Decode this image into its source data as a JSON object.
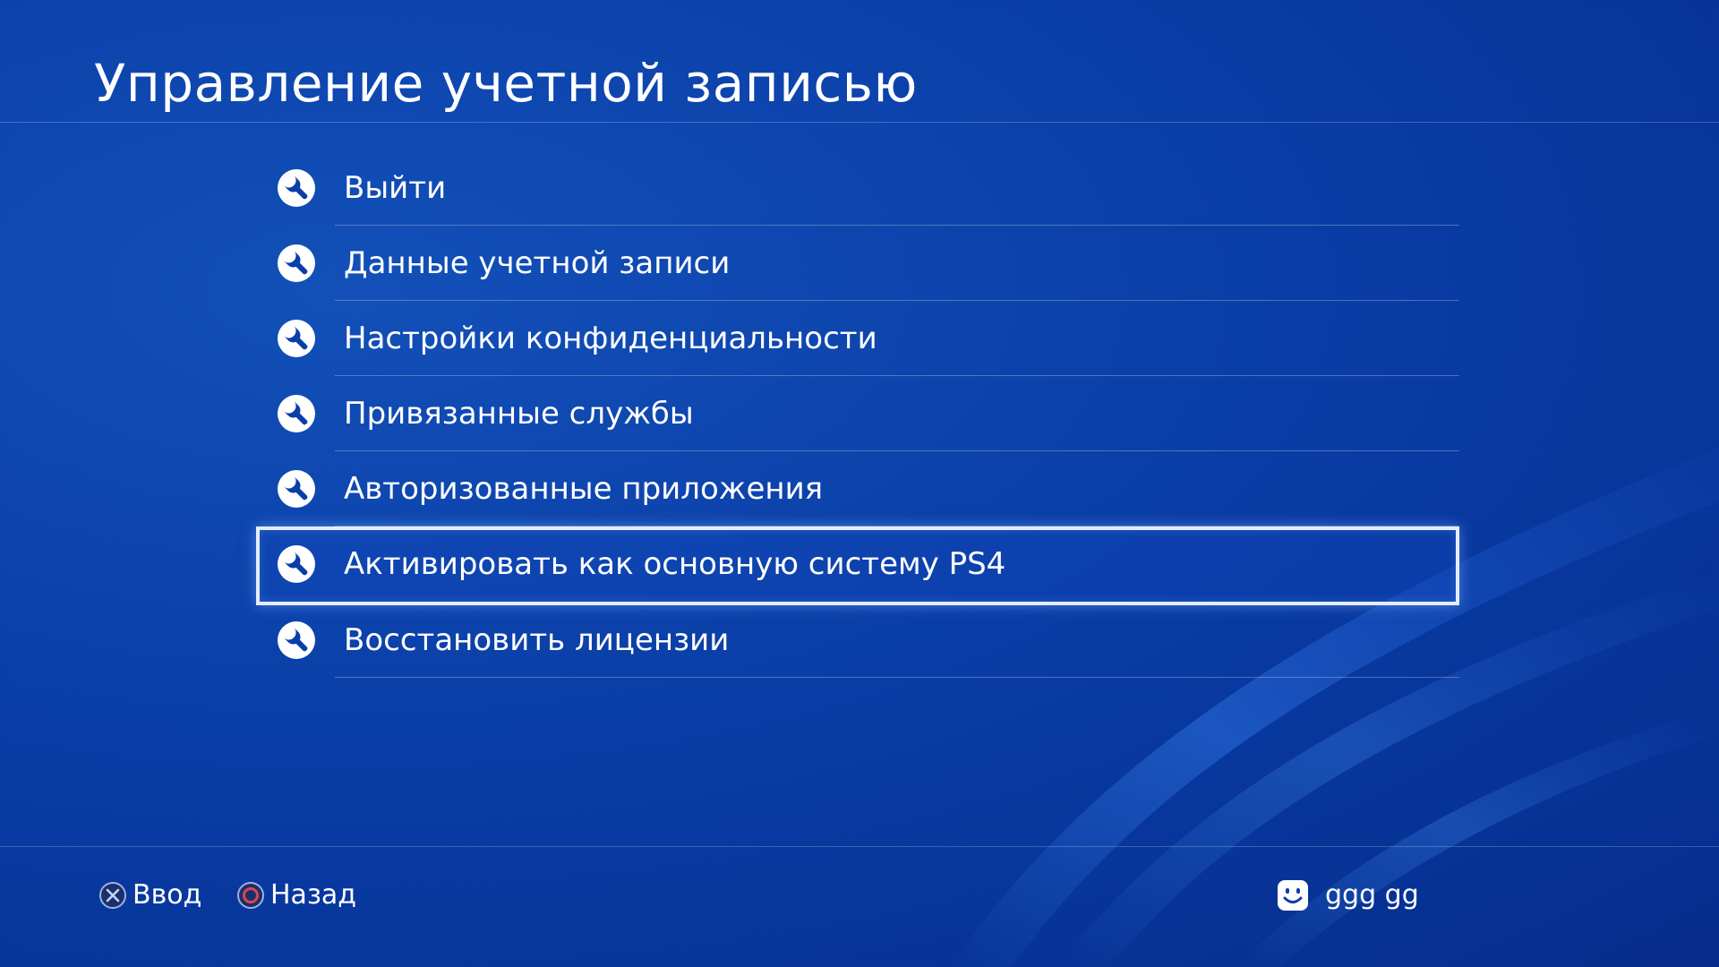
{
  "header": {
    "title": "Управление учетной записью"
  },
  "menu": {
    "selected_index": 5,
    "items": [
      {
        "label": "Выйти",
        "icon": "wrench-icon"
      },
      {
        "label": "Данные учетной записи",
        "icon": "wrench-icon"
      },
      {
        "label": "Настройки конфиденциальности",
        "icon": "wrench-icon"
      },
      {
        "label": "Привязанные службы",
        "icon": "wrench-icon"
      },
      {
        "label": "Авторизованные приложения",
        "icon": "wrench-icon"
      },
      {
        "label": "Активировать как основную систему PS4",
        "icon": "wrench-icon"
      },
      {
        "label": "Восстановить лицензии",
        "icon": "wrench-icon"
      }
    ]
  },
  "footer": {
    "enter": {
      "label": "Ввод",
      "icon": "cross-button-icon"
    },
    "back": {
      "label": "Назад",
      "icon": "circle-button-icon"
    },
    "user": {
      "name": "ggg gg",
      "icon": "avatar-icon"
    }
  },
  "colors": {
    "background": "#0a3da6",
    "selection_border": "#e4ecff",
    "circle_button": "#e0444f"
  }
}
